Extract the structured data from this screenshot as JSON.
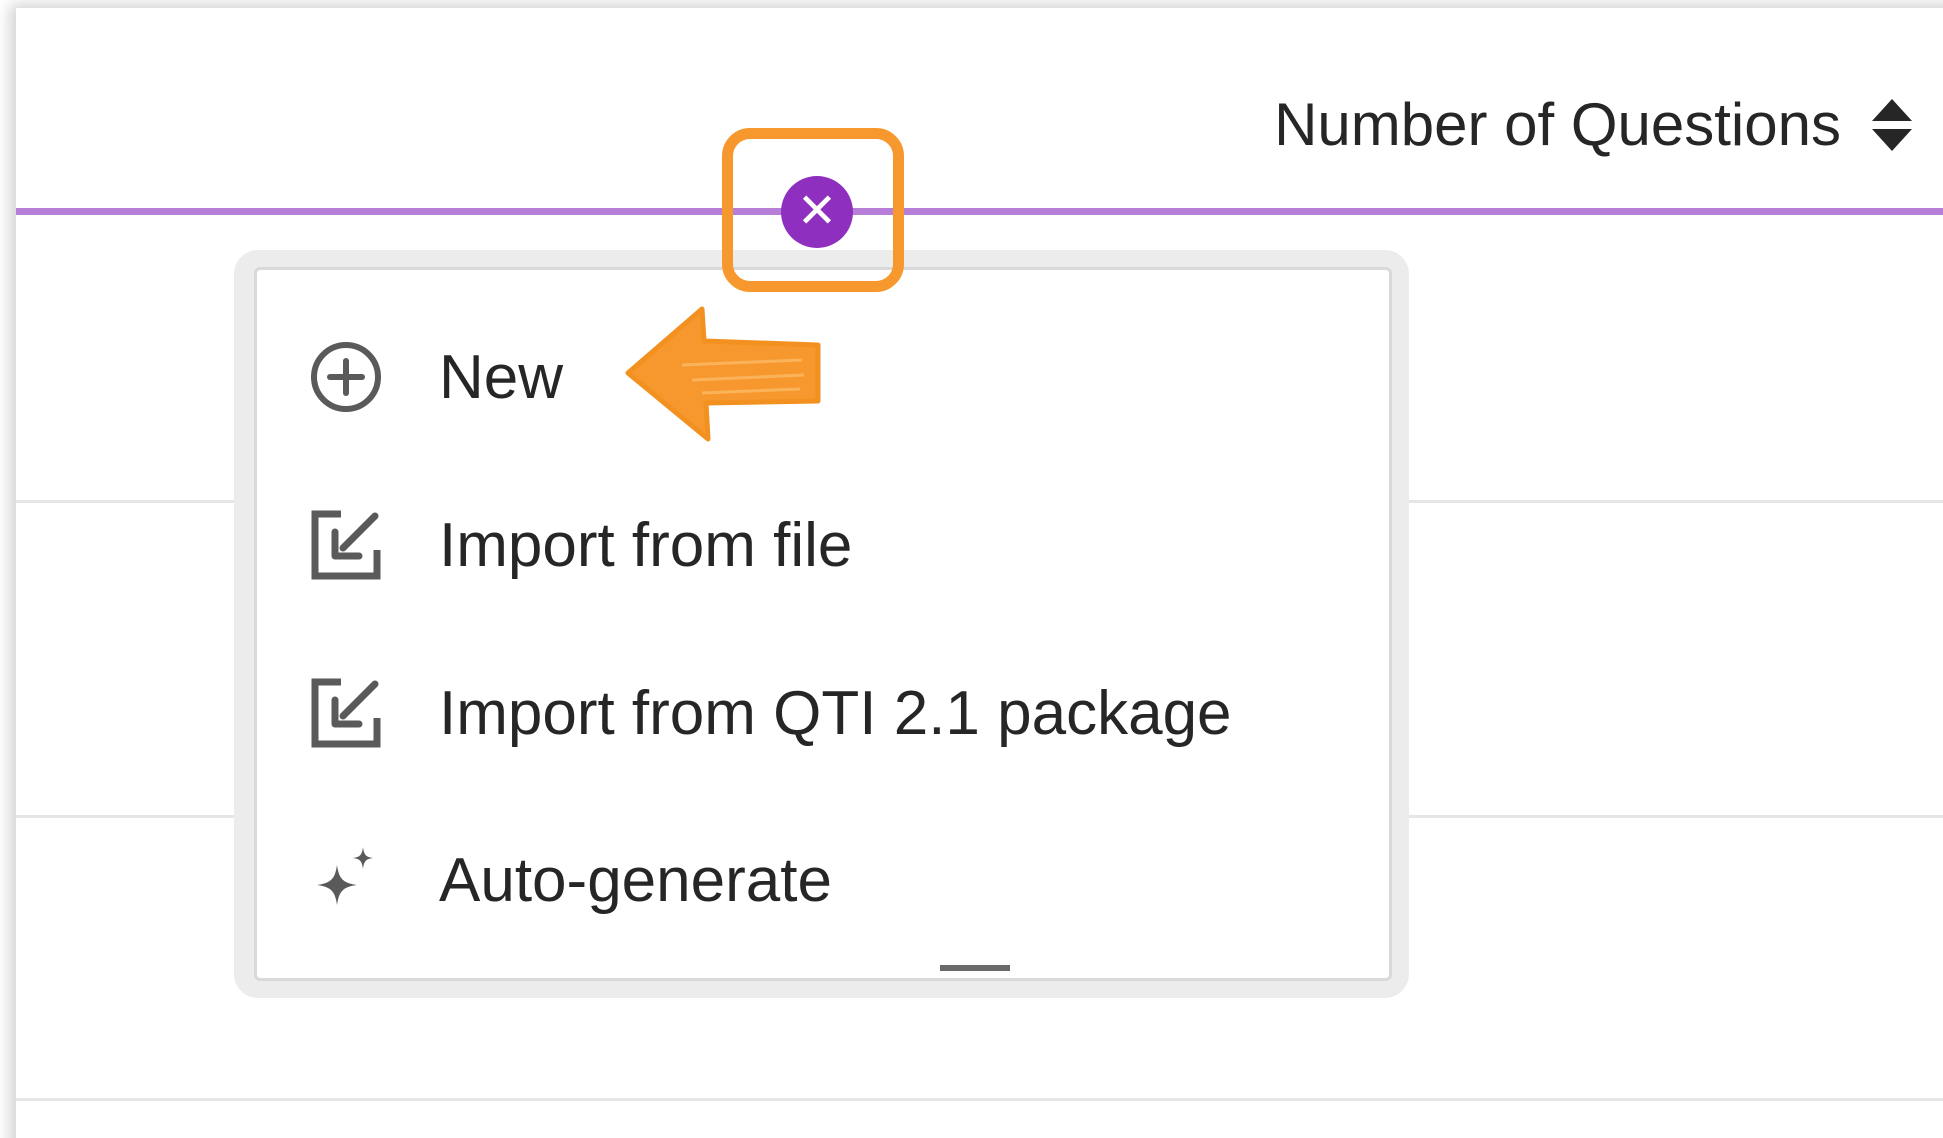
{
  "table_header": {
    "column_label": "Number of Questions",
    "sort_icon": "sort-icon"
  },
  "close_button": {
    "icon": "close-icon",
    "symbol": "✕",
    "color": "#8e2fbf"
  },
  "menu": {
    "items": [
      {
        "label": "New",
        "icon": "plus-circle-icon"
      },
      {
        "label": "Import from file",
        "icon": "import-icon"
      },
      {
        "label": "Import from QTI 2.1 package",
        "icon": "import-icon"
      },
      {
        "label": "Auto-generate",
        "icon": "sparkle-icon"
      }
    ]
  },
  "colors": {
    "accent_rule": "#b67ed6",
    "annotation": "#f7982e",
    "text": "#262626"
  }
}
